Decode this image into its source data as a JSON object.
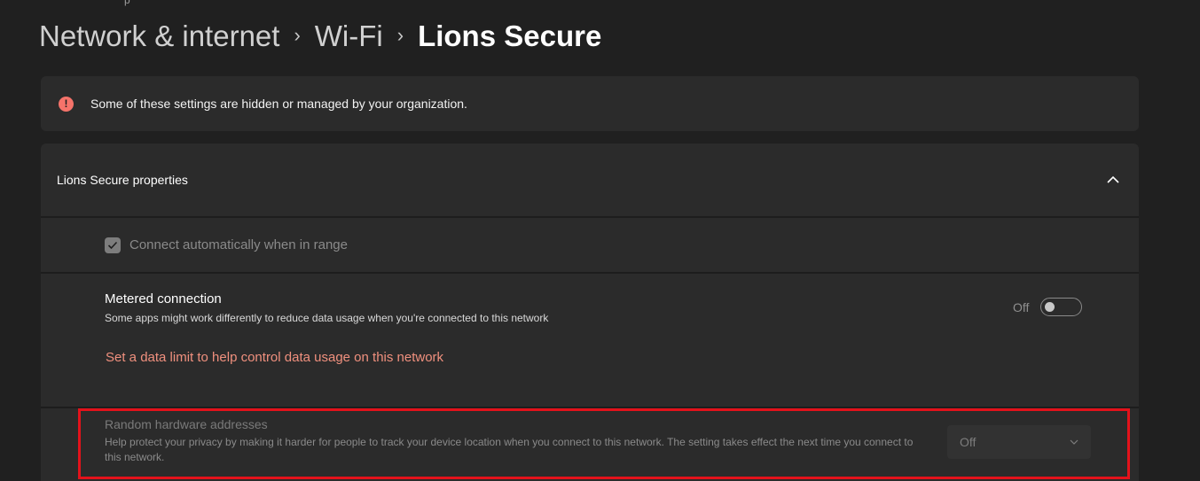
{
  "top_fragment": "p",
  "breadcrumb": {
    "items": [
      "Network & internet",
      "Wi-Fi"
    ],
    "current": "Lions Secure",
    "separator": "›"
  },
  "notice": {
    "icon": "info-icon",
    "icon_glyph": "!",
    "text": "Some of these settings are hidden or managed by your organization.",
    "color": "#f5736a"
  },
  "properties": {
    "title": "Lions Secure properties",
    "chevron": "^",
    "connect_auto": {
      "label": "Connect automatically when in range",
      "checked": true
    },
    "metered": {
      "title": "Metered connection",
      "description": "Some apps might work differently to reduce data usage when you're connected to this network",
      "state_label": "Off",
      "toggle_on": false,
      "link": "Set a data limit to help control data usage on this network",
      "link_color": "#f0907e"
    },
    "random_hw": {
      "title": "Random hardware addresses",
      "description": "Help protect your privacy by making it harder for people to track your device location when you connect to this network. The setting takes effect the next time you connect to this network.",
      "selected": "Off",
      "chevron": "⌄"
    }
  },
  "highlight_color": "#e3121b"
}
